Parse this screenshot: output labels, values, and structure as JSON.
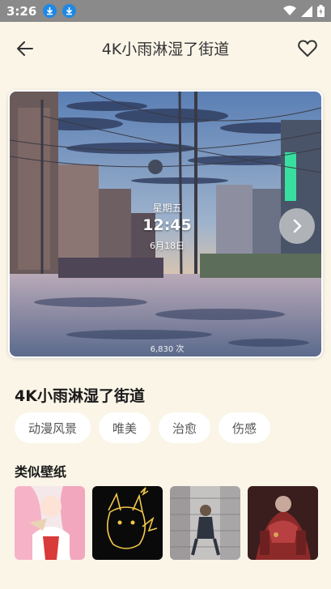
{
  "status_bar": {
    "time": "3:26"
  },
  "header": {
    "title": "4K小雨淋湿了街道"
  },
  "preview": {
    "weekday": "星期五",
    "time": "12:45",
    "date": "6月18日",
    "count": "6,830 次"
  },
  "wallpaper": {
    "title": "4K小雨淋湿了街道",
    "tags": [
      "动漫风景",
      "唯美",
      "治愈",
      "伤感"
    ]
  },
  "similar": {
    "title": "类似壁纸",
    "items": [
      "anime-girl-pink-hair",
      "neon-pikachu",
      "city-girl-street",
      "red-mech-robot"
    ]
  },
  "colors": {
    "background": "#fbf5e8",
    "status_bar": "#8a8a8a",
    "download_badge": "#1e88e5",
    "tag_bg": "#ffffff"
  }
}
